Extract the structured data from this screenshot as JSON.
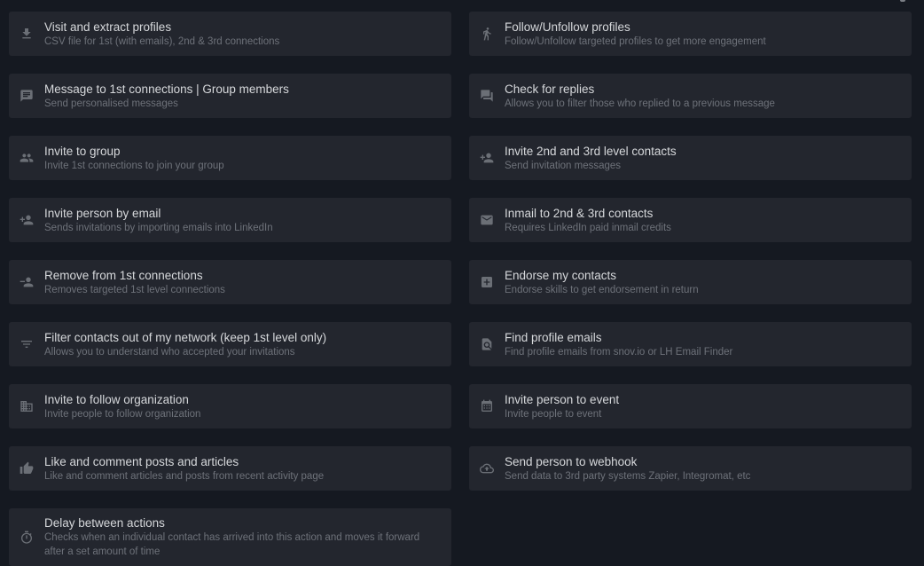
{
  "actions": [
    {
      "icon": "download-icon",
      "title": "Visit and extract profiles",
      "subtitle": "CSV file for 1st (with emails), 2nd & 3rd connections"
    },
    {
      "icon": "walking-person-icon",
      "title": "Follow/Unfollow profiles",
      "subtitle": "Follow/Unfollow targeted profiles to get more engagement"
    },
    {
      "icon": "chat-message-icon",
      "title": "Message to 1st connections | Group members",
      "subtitle": "Send personalised messages"
    },
    {
      "icon": "forum-icon",
      "title": "Check for replies",
      "subtitle": "Allows you to filter those who replied to a previous message"
    },
    {
      "icon": "group-icon",
      "title": "Invite to group",
      "subtitle": "Invite 1st connections to join your group"
    },
    {
      "icon": "person-add-icon",
      "title": "Invite 2nd and 3rd level contacts",
      "subtitle": "Send invitation messages"
    },
    {
      "icon": "person-add-icon",
      "title": "Invite person by email",
      "subtitle": "Sends invitations by importing emails into LinkedIn"
    },
    {
      "icon": "mail-icon",
      "title": "Inmail to 2nd & 3rd contacts",
      "subtitle": "Requires LinkedIn paid inmail credits"
    },
    {
      "icon": "person-remove-icon",
      "title": "Remove from 1st connections",
      "subtitle": "Removes targeted 1st level connections"
    },
    {
      "icon": "plus-box-icon",
      "title": "Endorse my contacts",
      "subtitle": "Endorse skills to get endorsement in return"
    },
    {
      "icon": "filter-icon",
      "title": "Filter contacts out of my network (keep 1st level only)",
      "subtitle": "Allows you to understand who accepted your invitations"
    },
    {
      "icon": "find-in-page-icon",
      "title": "Find profile emails",
      "subtitle": "Find profile emails from snov.io or LH Email Finder"
    },
    {
      "icon": "building-icon",
      "title": "Invite to follow organization",
      "subtitle": "Invite people to follow organization"
    },
    {
      "icon": "calendar-icon",
      "title": "Invite person to event",
      "subtitle": "Invite people to event"
    },
    {
      "icon": "thumb-up-icon",
      "title": "Like and comment posts and articles",
      "subtitle": "Like and comment articles and posts from recent activity page"
    },
    {
      "icon": "cloud-upload-icon",
      "title": "Send person to webhook",
      "subtitle": "Send data to 3rd party systems Zapier, Integromat, etc"
    },
    {
      "icon": "timer-icon",
      "title": "Delay between actions",
      "subtitle": "Checks when an individual contact has arrived into this action and moves it forward after a set amount of time"
    }
  ],
  "colors": {
    "background": "#151921",
    "card": "#23262e",
    "title": "#d6d8db",
    "subtitle": "#6e727a",
    "icon": "#6b6f76"
  }
}
